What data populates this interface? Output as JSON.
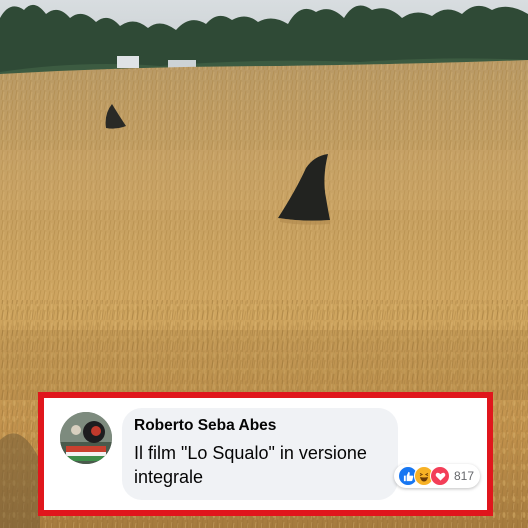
{
  "comment": {
    "author": "Roberto Seba Abes",
    "text": "Il film \"Lo Squalo\" in versione integrale",
    "reactions": {
      "icons": [
        "like-icon",
        "haha-icon",
        "love-icon"
      ],
      "count": "817"
    }
  },
  "colors": {
    "frame": "#e0161c",
    "like": "#1877f2",
    "haha": "#f7b125",
    "love": "#f33e58"
  }
}
